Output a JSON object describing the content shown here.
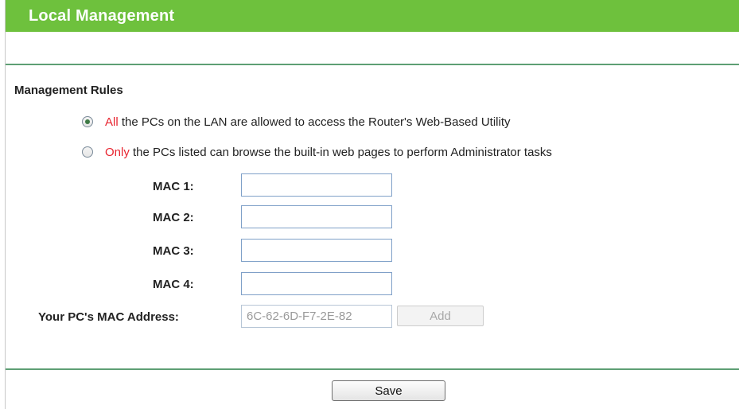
{
  "header": {
    "title": "Local Management"
  },
  "management_rules": {
    "title": "Management Rules",
    "options": [
      {
        "highlight": "All",
        "text": " the PCs on the LAN are allowed to access the Router's Web-Based Utility",
        "selected": true
      },
      {
        "highlight": "Only",
        "text": " the PCs listed can browse the built-in web pages to perform Administrator tasks",
        "selected": false
      }
    ]
  },
  "mac_fields": [
    {
      "label": "MAC 1:",
      "value": ""
    },
    {
      "label": "MAC 2:",
      "value": ""
    },
    {
      "label": "MAC 3:",
      "value": ""
    },
    {
      "label": "MAC 4:",
      "value": ""
    }
  ],
  "your_pc": {
    "label": "Your PC's MAC Address:",
    "value": "6C-62-6D-F7-2E-82",
    "add_label": "Add"
  },
  "footer": {
    "save_label": "Save"
  },
  "colors": {
    "header_green": "#6ec13d",
    "divider": "#5e9f74",
    "highlight_red": "#e8242f"
  }
}
